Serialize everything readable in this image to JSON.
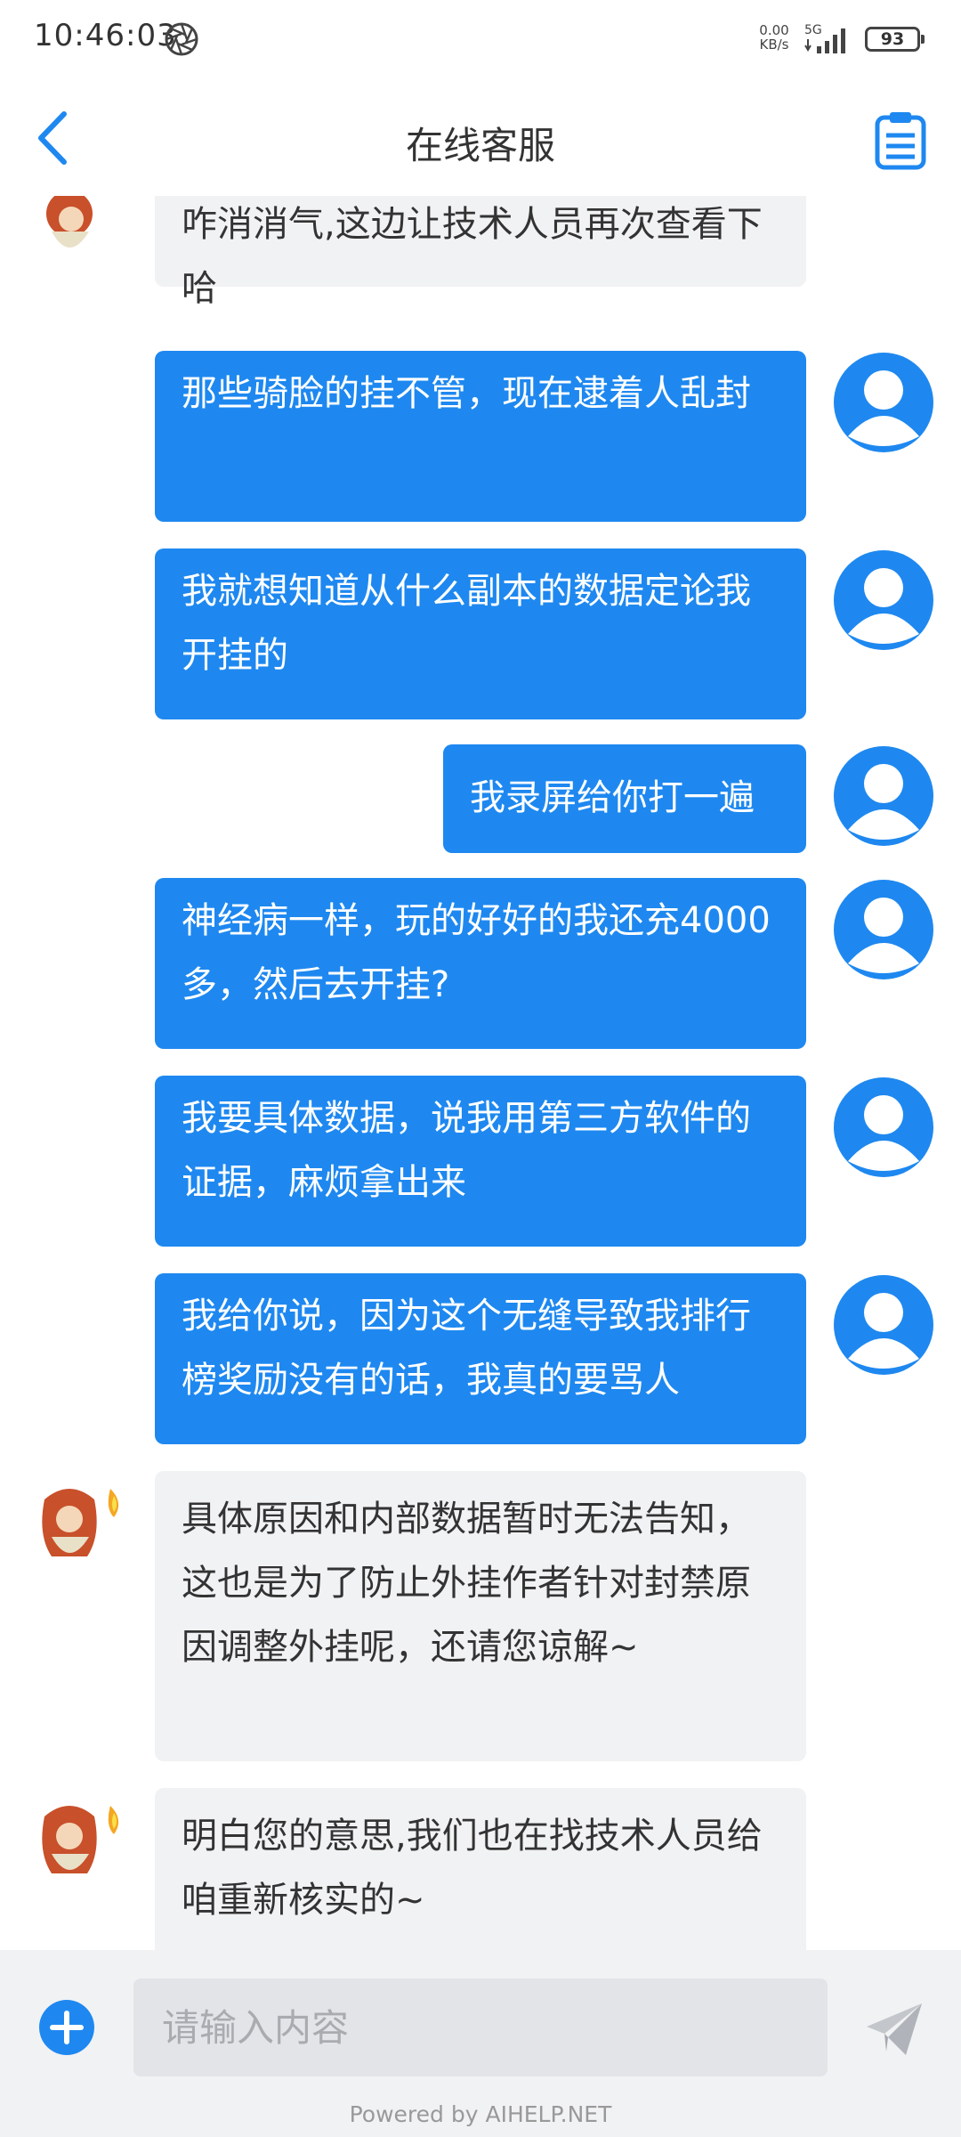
{
  "status_bar": {
    "time": "10:46:03",
    "net_speed_value": "0.00",
    "net_speed_unit": "KB/s",
    "network": "5G",
    "battery": "93"
  },
  "header": {
    "title": "在线客服"
  },
  "messages": [
    {
      "from": "agent",
      "text": "咋消消气,这边让技术人员再次查看下哈"
    },
    {
      "from": "user",
      "text": "那些骑脸的挂不管，现在逮着人乱封"
    },
    {
      "from": "user",
      "text": "我就想知道从什么副本的数据定论我开挂的"
    },
    {
      "from": "user",
      "text": "我录屏给你打一遍"
    },
    {
      "from": "user",
      "text": "神经病一样，玩的好好的我还充4000多，然后去开挂?"
    },
    {
      "from": "user",
      "text": "我要具体数据，说我用第三方软件的证据，麻烦拿出来"
    },
    {
      "from": "user",
      "text": "我给你说，因为这个无缝导致我排行榜奖励没有的话，我真的要骂人"
    },
    {
      "from": "agent",
      "text": "具体原因和内部数据暂时无法告知，这也是为了防止外挂作者针对封禁原因调整外挂呢，还请您谅解~"
    },
    {
      "from": "agent",
      "text": "明白您的意思,我们也在找技术人员给咱重新核实的~"
    }
  ],
  "input": {
    "placeholder": "请输入内容"
  },
  "footer": {
    "powered_by": "Powered by AIHELP.NET"
  },
  "colors": {
    "accent": "#1e88f0",
    "agent_bubble": "#f1f2f4",
    "input_bar": "#f1f2f4"
  },
  "icons": {
    "back": "chevron-left-icon",
    "clipboard": "clipboard-icon",
    "add": "plus-circle-icon",
    "send": "paper-plane-icon",
    "user_avatar": "user-avatar-icon",
    "agent_avatar": "agent-avatar"
  }
}
